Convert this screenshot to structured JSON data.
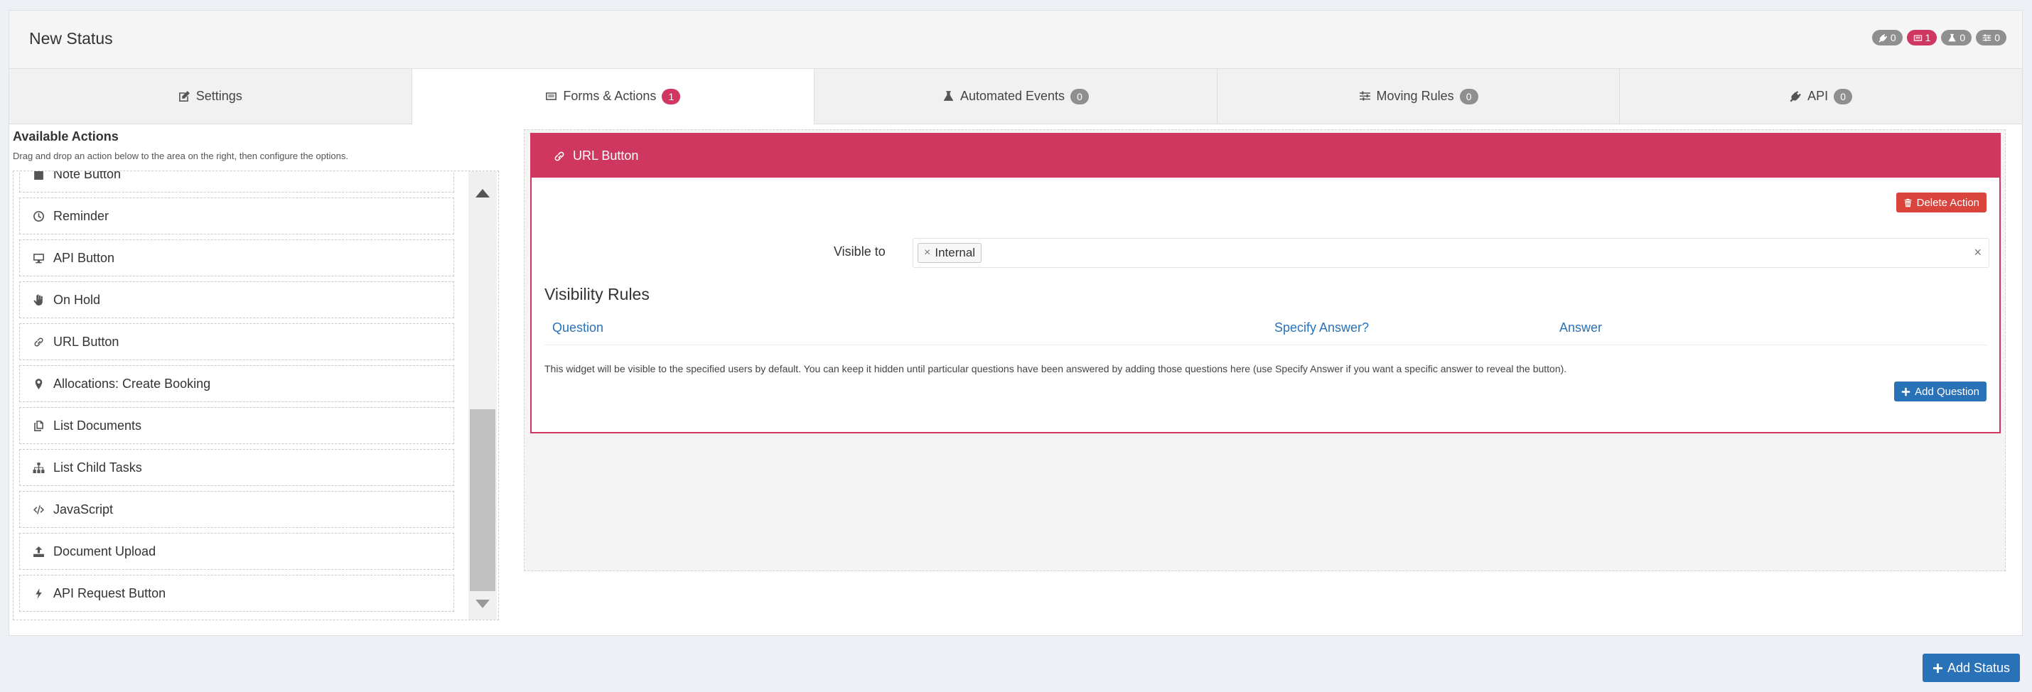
{
  "header": {
    "title": "New Status",
    "badges": [
      {
        "icon": "plug-icon",
        "count": "0"
      },
      {
        "icon": "form-icon",
        "count": "1",
        "color": "#cf3660"
      },
      {
        "icon": "flask-icon",
        "count": "0"
      },
      {
        "icon": "sliders-icon",
        "count": "0"
      }
    ]
  },
  "tabs": [
    {
      "label": "Settings",
      "icon": "edit-icon"
    },
    {
      "label": "Forms & Actions",
      "icon": "form-icon",
      "count": "1",
      "active": true
    },
    {
      "label": "Automated Events",
      "icon": "flask-icon",
      "count": "0"
    },
    {
      "label": "Moving Rules",
      "icon": "sliders-icon",
      "count": "0"
    },
    {
      "label": "API",
      "icon": "plug-icon",
      "count": "0"
    }
  ],
  "available": {
    "title": "Available Actions",
    "subtitle": "Drag and drop an action below to the area on the right, then configure the options.",
    "items": [
      {
        "label": "Note Button",
        "icon": "note-icon"
      },
      {
        "label": "Reminder",
        "icon": "clock-icon"
      },
      {
        "label": "API Button",
        "icon": "monitor-icon"
      },
      {
        "label": "On Hold",
        "icon": "hand-icon"
      },
      {
        "label": "URL Button",
        "icon": "link-icon"
      },
      {
        "label": "Allocations: Create Booking",
        "icon": "map-marker-icon"
      },
      {
        "label": "List Documents",
        "icon": "copy-icon"
      },
      {
        "label": "List Child Tasks",
        "icon": "sitemap-icon"
      },
      {
        "label": "JavaScript",
        "icon": "code-icon"
      },
      {
        "label": "Document Upload",
        "icon": "upload-icon"
      },
      {
        "label": "API Request Button",
        "icon": "bolt-icon"
      }
    ]
  },
  "url_action": {
    "title": "URL Button",
    "delete_label": "Delete Action",
    "visible_to_label": "Visible to",
    "visible_to_tags": [
      "Internal"
    ],
    "tag_remove": "×",
    "clear": "×",
    "rules_title": "Visibility Rules",
    "columns": [
      "Question",
      "Specify Answer?",
      "Answer"
    ],
    "help": "This widget will be visible to the specified users by default. You can keep it hidden until particular questions have been answered by adding those questions here (use Specify Answer if you want a specific answer to reveal the button).",
    "add_question_label": "Add Question"
  },
  "footer": {
    "add_status_label": "Add Status"
  },
  "colors": {
    "accent": "#cf3660",
    "primary": "#2a72b8",
    "danger": "#d9453d",
    "badge_grey": "#8f8f8f"
  }
}
